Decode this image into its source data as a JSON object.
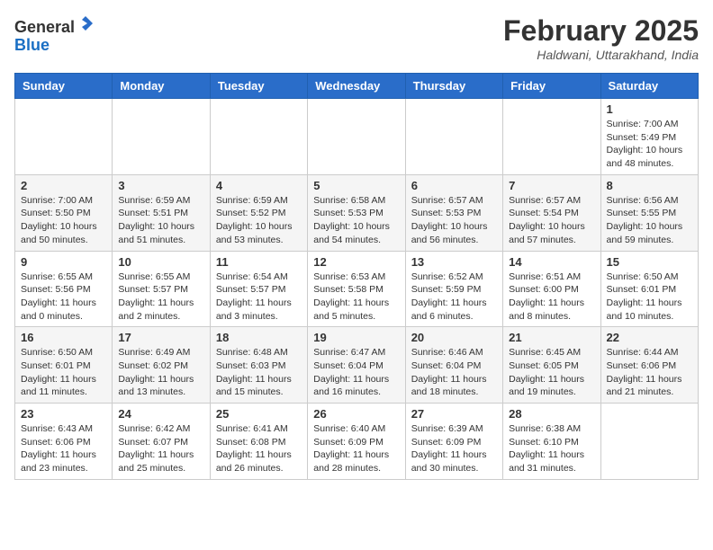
{
  "header": {
    "logo_general": "General",
    "logo_blue": "Blue",
    "month_title": "February 2025",
    "location": "Haldwani, Uttarakhand, India"
  },
  "weekdays": [
    "Sunday",
    "Monday",
    "Tuesday",
    "Wednesday",
    "Thursday",
    "Friday",
    "Saturday"
  ],
  "weeks": [
    [
      {
        "day": "",
        "info": ""
      },
      {
        "day": "",
        "info": ""
      },
      {
        "day": "",
        "info": ""
      },
      {
        "day": "",
        "info": ""
      },
      {
        "day": "",
        "info": ""
      },
      {
        "day": "",
        "info": ""
      },
      {
        "day": "1",
        "info": "Sunrise: 7:00 AM\nSunset: 5:49 PM\nDaylight: 10 hours\nand 48 minutes."
      }
    ],
    [
      {
        "day": "2",
        "info": "Sunrise: 7:00 AM\nSunset: 5:50 PM\nDaylight: 10 hours\nand 50 minutes."
      },
      {
        "day": "3",
        "info": "Sunrise: 6:59 AM\nSunset: 5:51 PM\nDaylight: 10 hours\nand 51 minutes."
      },
      {
        "day": "4",
        "info": "Sunrise: 6:59 AM\nSunset: 5:52 PM\nDaylight: 10 hours\nand 53 minutes."
      },
      {
        "day": "5",
        "info": "Sunrise: 6:58 AM\nSunset: 5:53 PM\nDaylight: 10 hours\nand 54 minutes."
      },
      {
        "day": "6",
        "info": "Sunrise: 6:57 AM\nSunset: 5:53 PM\nDaylight: 10 hours\nand 56 minutes."
      },
      {
        "day": "7",
        "info": "Sunrise: 6:57 AM\nSunset: 5:54 PM\nDaylight: 10 hours\nand 57 minutes."
      },
      {
        "day": "8",
        "info": "Sunrise: 6:56 AM\nSunset: 5:55 PM\nDaylight: 10 hours\nand 59 minutes."
      }
    ],
    [
      {
        "day": "9",
        "info": "Sunrise: 6:55 AM\nSunset: 5:56 PM\nDaylight: 11 hours\nand 0 minutes."
      },
      {
        "day": "10",
        "info": "Sunrise: 6:55 AM\nSunset: 5:57 PM\nDaylight: 11 hours\nand 2 minutes."
      },
      {
        "day": "11",
        "info": "Sunrise: 6:54 AM\nSunset: 5:57 PM\nDaylight: 11 hours\nand 3 minutes."
      },
      {
        "day": "12",
        "info": "Sunrise: 6:53 AM\nSunset: 5:58 PM\nDaylight: 11 hours\nand 5 minutes."
      },
      {
        "day": "13",
        "info": "Sunrise: 6:52 AM\nSunset: 5:59 PM\nDaylight: 11 hours\nand 6 minutes."
      },
      {
        "day": "14",
        "info": "Sunrise: 6:51 AM\nSunset: 6:00 PM\nDaylight: 11 hours\nand 8 minutes."
      },
      {
        "day": "15",
        "info": "Sunrise: 6:50 AM\nSunset: 6:01 PM\nDaylight: 11 hours\nand 10 minutes."
      }
    ],
    [
      {
        "day": "16",
        "info": "Sunrise: 6:50 AM\nSunset: 6:01 PM\nDaylight: 11 hours\nand 11 minutes."
      },
      {
        "day": "17",
        "info": "Sunrise: 6:49 AM\nSunset: 6:02 PM\nDaylight: 11 hours\nand 13 minutes."
      },
      {
        "day": "18",
        "info": "Sunrise: 6:48 AM\nSunset: 6:03 PM\nDaylight: 11 hours\nand 15 minutes."
      },
      {
        "day": "19",
        "info": "Sunrise: 6:47 AM\nSunset: 6:04 PM\nDaylight: 11 hours\nand 16 minutes."
      },
      {
        "day": "20",
        "info": "Sunrise: 6:46 AM\nSunset: 6:04 PM\nDaylight: 11 hours\nand 18 minutes."
      },
      {
        "day": "21",
        "info": "Sunrise: 6:45 AM\nSunset: 6:05 PM\nDaylight: 11 hours\nand 19 minutes."
      },
      {
        "day": "22",
        "info": "Sunrise: 6:44 AM\nSunset: 6:06 PM\nDaylight: 11 hours\nand 21 minutes."
      }
    ],
    [
      {
        "day": "23",
        "info": "Sunrise: 6:43 AM\nSunset: 6:06 PM\nDaylight: 11 hours\nand 23 minutes."
      },
      {
        "day": "24",
        "info": "Sunrise: 6:42 AM\nSunset: 6:07 PM\nDaylight: 11 hours\nand 25 minutes."
      },
      {
        "day": "25",
        "info": "Sunrise: 6:41 AM\nSunset: 6:08 PM\nDaylight: 11 hours\nand 26 minutes."
      },
      {
        "day": "26",
        "info": "Sunrise: 6:40 AM\nSunset: 6:09 PM\nDaylight: 11 hours\nand 28 minutes."
      },
      {
        "day": "27",
        "info": "Sunrise: 6:39 AM\nSunset: 6:09 PM\nDaylight: 11 hours\nand 30 minutes."
      },
      {
        "day": "28",
        "info": "Sunrise: 6:38 AM\nSunset: 6:10 PM\nDaylight: 11 hours\nand 31 minutes."
      },
      {
        "day": "",
        "info": ""
      }
    ]
  ]
}
